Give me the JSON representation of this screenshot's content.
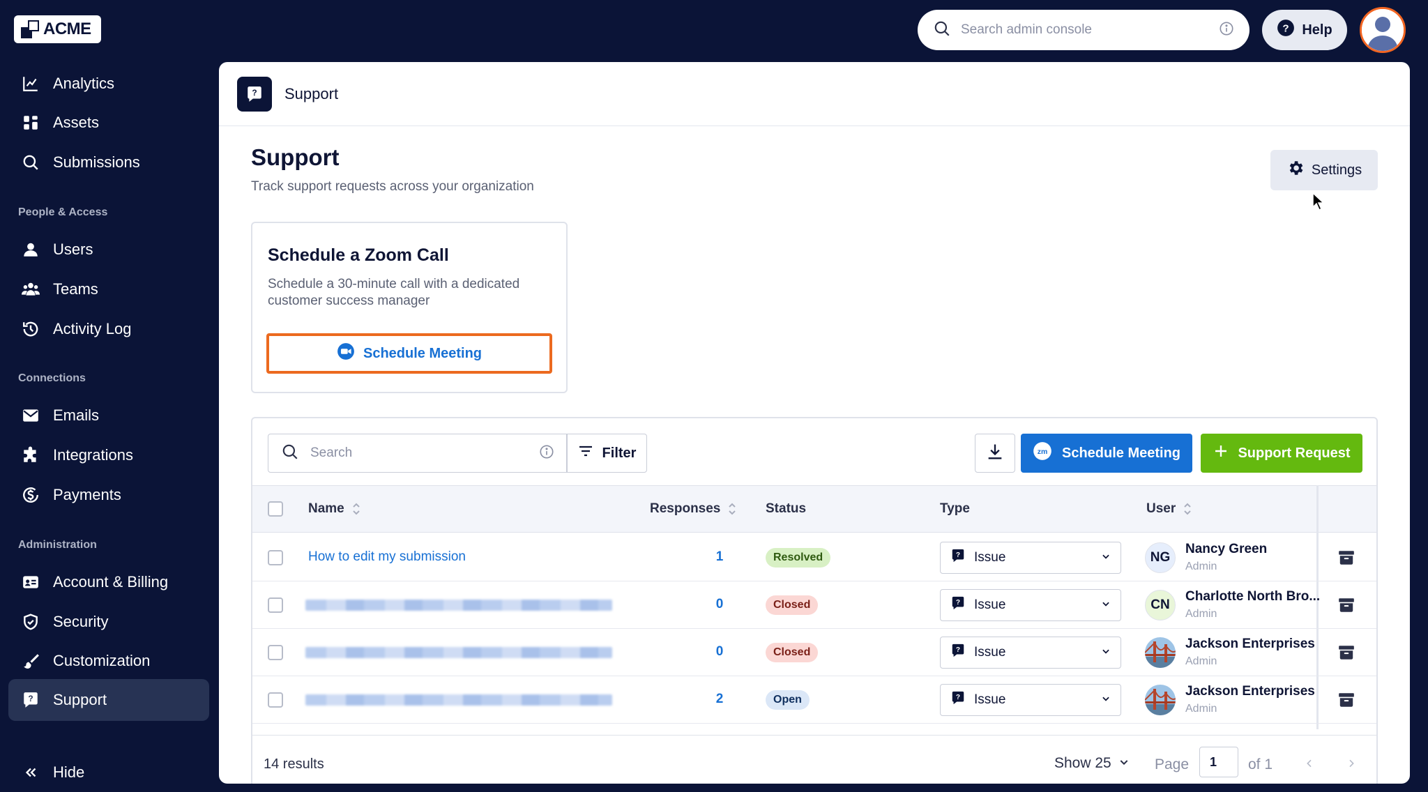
{
  "logo": {
    "text": "ACME"
  },
  "sidebar": {
    "items_top": [
      {
        "label": "Analytics",
        "icon": "chart-line-icon"
      },
      {
        "label": "Assets",
        "icon": "grid-icon"
      },
      {
        "label": "Submissions",
        "icon": "search-icon"
      }
    ],
    "section_people": "People & Access",
    "items_people": [
      {
        "label": "Users",
        "icon": "user-icon"
      },
      {
        "label": "Teams",
        "icon": "team-icon"
      },
      {
        "label": "Activity Log",
        "icon": "history-icon"
      }
    ],
    "section_connections": "Connections",
    "items_connections": [
      {
        "label": "Emails",
        "icon": "mail-icon"
      },
      {
        "label": "Integrations",
        "icon": "puzzle-icon"
      },
      {
        "label": "Payments",
        "icon": "dollar-icon"
      }
    ],
    "section_admin": "Administration",
    "items_admin": [
      {
        "label": "Account & Billing",
        "icon": "id-card-icon"
      },
      {
        "label": "Security",
        "icon": "shield-icon"
      },
      {
        "label": "Customization",
        "icon": "brush-icon"
      },
      {
        "label": "Support",
        "icon": "support-icon",
        "active": true
      }
    ],
    "hide_label": "Hide"
  },
  "topbar": {
    "search_placeholder": "Search admin console",
    "help_label": "Help"
  },
  "breadcrumb": {
    "label": "Support"
  },
  "page": {
    "title": "Support",
    "subtitle": "Track support requests across your organization",
    "settings_label": "Settings"
  },
  "zoom_card": {
    "title": "Schedule a Zoom Call",
    "description": "Schedule a 30-minute call with a dedicated customer success manager",
    "button_label": "Schedule Meeting"
  },
  "toolbar": {
    "search_placeholder": "Search",
    "filter_label": "Filter",
    "schedule_label": "Schedule Meeting",
    "request_label": "Support Request",
    "zoom_badge": "zm"
  },
  "table": {
    "columns": {
      "name": "Name",
      "responses": "Responses",
      "status": "Status",
      "type": "Type",
      "user": "User"
    },
    "rows": [
      {
        "name": "How to edit my submission",
        "blurred": false,
        "responses": "1",
        "status": "Resolved",
        "status_color": "#d8f0c4",
        "status_text": "#2f5a10",
        "type": "Issue",
        "user_initials": "NG",
        "user_bg": "#e6eefc",
        "user_name": "Nancy Green",
        "user_role": "Admin"
      },
      {
        "name": "",
        "blurred": true,
        "responses": "0",
        "status": "Closed",
        "status_color": "#fbd7d4",
        "status_text": "#7a1f17",
        "type": "Issue",
        "user_initials": "CN",
        "user_bg": "#e9f6d9",
        "user_name": "Charlotte North Bro...",
        "user_role": "Admin"
      },
      {
        "name": "",
        "blurred": true,
        "responses": "0",
        "status": "Closed",
        "status_color": "#fbd7d4",
        "status_text": "#7a1f17",
        "type": "Issue",
        "user_initials": "",
        "user_bg": "photo",
        "user_name": "Jackson Enterprises",
        "user_role": "Admin"
      },
      {
        "name": "",
        "blurred": true,
        "responses": "2",
        "status": "Open",
        "status_color": "#dbe7f7",
        "status_text": "#0f2f5e",
        "type": "Issue",
        "user_initials": "",
        "user_bg": "photo",
        "user_name": "Jackson Enterprises",
        "user_role": "Admin"
      }
    ]
  },
  "footer": {
    "results": "14 results",
    "show_label": "Show 25",
    "page_label": "Page",
    "page_value": "1",
    "of_label": "of 1"
  },
  "colors": {
    "navy": "#0b1437",
    "blue": "#1770d4",
    "green": "#64b90f",
    "orange": "#ec6a1f"
  }
}
